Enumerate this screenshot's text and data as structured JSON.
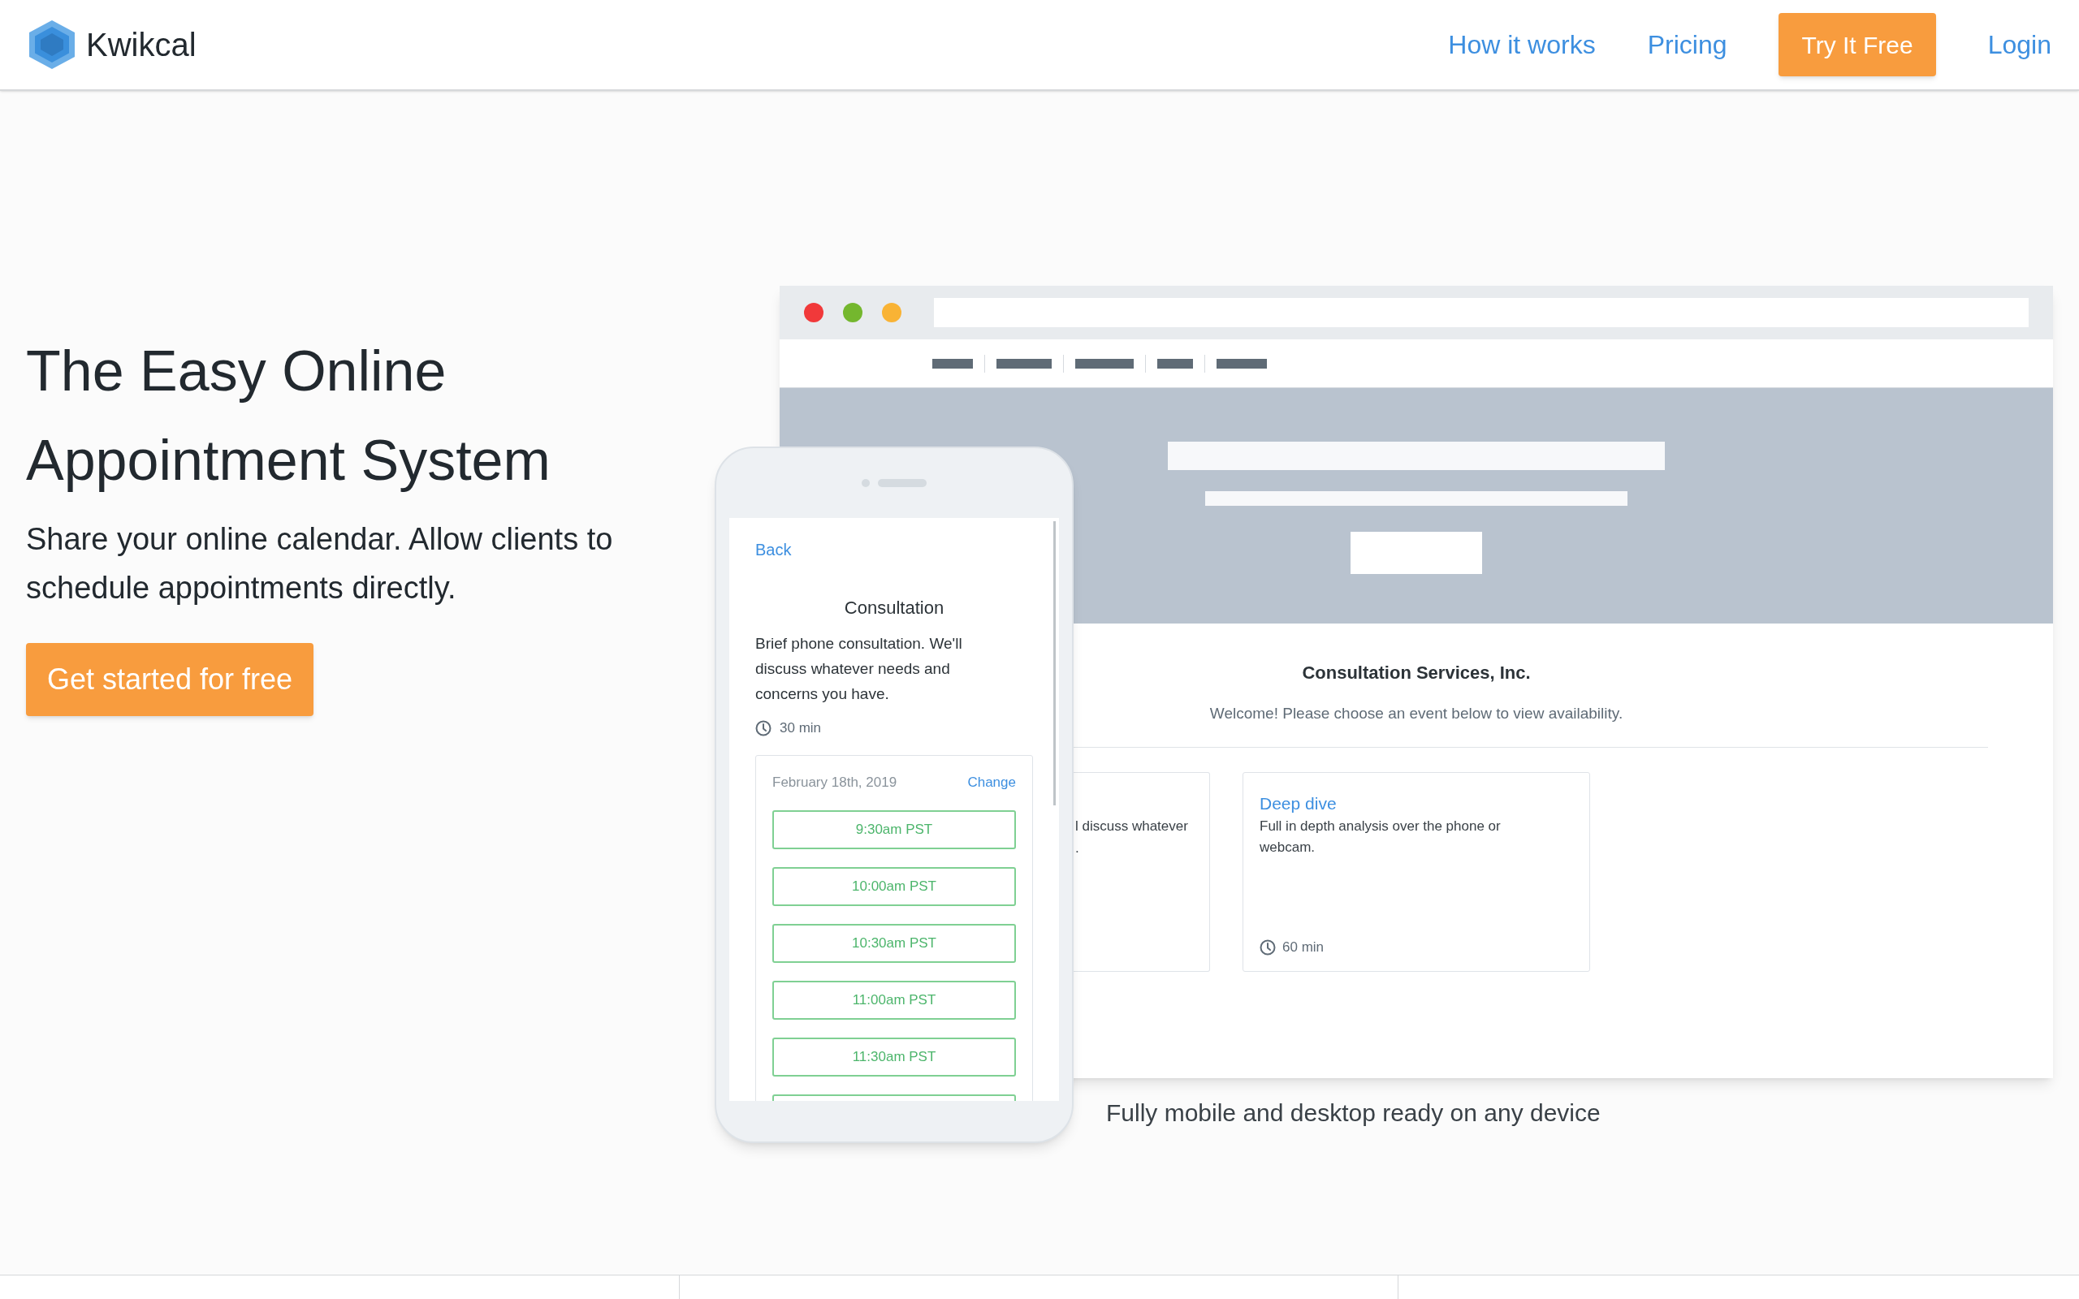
{
  "header": {
    "brand": "Kwikcal",
    "nav": [
      {
        "label": "How it works",
        "kind": "link"
      },
      {
        "label": "Pricing",
        "kind": "link"
      },
      {
        "label": "Try It Free",
        "kind": "button"
      },
      {
        "label": "Login",
        "kind": "link"
      }
    ]
  },
  "hero": {
    "title_lines": [
      "The Easy Online",
      "Appointment System"
    ],
    "subtitle": "Share your online calendar. Allow clients to schedule appointments directly.",
    "cta": "Get started for free"
  },
  "desktop_preview": {
    "company": "Consultation Services, Inc.",
    "welcome": "Welcome! Please choose an event below to view availability.",
    "events": [
      {
        "kind": "partial",
        "description_lines": [
          "l discuss whatever",
          "."
        ]
      },
      {
        "kind": "full",
        "title": "Deep dive",
        "description": "Full in depth analysis over the phone or webcam.",
        "duration": "60 min"
      }
    ]
  },
  "mobile_preview": {
    "back": "Back",
    "title": "Consultation",
    "description": "Brief phone consultation. We'll discuss whatever needs and concerns you have.",
    "duration": "30 min",
    "date": "February 18th, 2019",
    "change": "Change",
    "slots": [
      "9:30am PST",
      "10:00am PST",
      "10:30am PST",
      "11:00am PST",
      "11:30am PST"
    ]
  },
  "caption": "Fully mobile and desktop ready on any device"
}
